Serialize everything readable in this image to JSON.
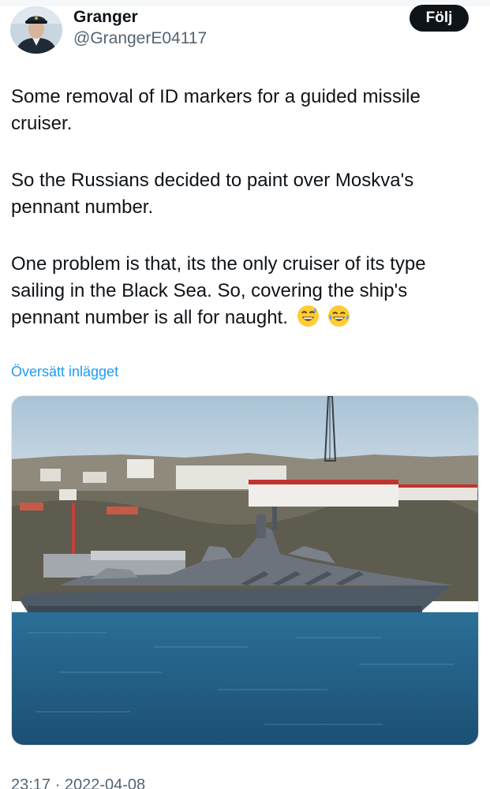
{
  "author": {
    "display_name": "Granger",
    "handle": "@GrangerE04117",
    "follow_label": "Följ"
  },
  "tweet": {
    "paragraphs": [
      "Some removal of ID markers for a guided missile cruiser.",
      "So the Russians decided to paint over Moskva's pennant number.",
      "One problem is that, its the only cruiser of its type sailing in the Black Sea. So, covering the ship's pennant number is all for naught."
    ],
    "emojis": [
      "grinning-sweat-emoji",
      "tears-of-joy-emoji"
    ],
    "translate_label": "Översätt inlägget",
    "timestamp": "23:17 · 2022-04-08"
  },
  "colors": {
    "link": "#1d9bf0",
    "text": "#0f1419",
    "secondary_text": "#536471",
    "follow_button_bg": "#0f1419"
  }
}
